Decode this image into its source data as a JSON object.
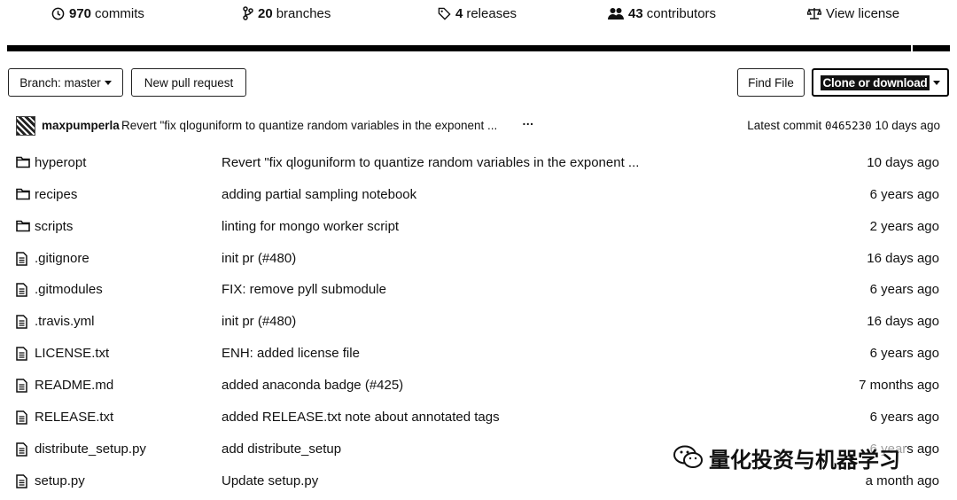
{
  "summary": {
    "commits": {
      "num": "970",
      "label": "commits",
      "icon": "history-icon"
    },
    "branches": {
      "num": "20",
      "label": "branches",
      "icon": "branch-icon"
    },
    "releases": {
      "num": "4",
      "label": "releases",
      "icon": "tag-icon"
    },
    "contributors": {
      "num": "43",
      "label": "contributors",
      "icon": "people-icon"
    },
    "license": {
      "label": "View license",
      "icon": "law-icon"
    }
  },
  "toolbar": {
    "branch_label": "Branch: master",
    "new_pr_label": "New pull request",
    "find_file_label": "Find File",
    "clone_label": "Clone or download"
  },
  "latest_commit": {
    "author": "maxpumperla",
    "message": "Revert \"fix qloguniform to quantize random variables in the exponent ...",
    "ellipsis": "…",
    "prefix": "Latest commit",
    "sha": "0465230",
    "age": "10 days ago"
  },
  "files": [
    {
      "type": "dir",
      "name": "hyperopt",
      "message": "Revert \"fix qloguniform to quantize random variables in the exponent ...",
      "age": "10 days ago"
    },
    {
      "type": "dir",
      "name": "recipes",
      "message": "adding partial sampling notebook",
      "age": "6 years ago"
    },
    {
      "type": "dir",
      "name": "scripts",
      "message": "linting for mongo worker script",
      "age": "2 years ago"
    },
    {
      "type": "file",
      "name": ".gitignore",
      "message": "init pr (#480)",
      "age": "16 days ago"
    },
    {
      "type": "file",
      "name": ".gitmodules",
      "message": "FIX: remove pyll submodule",
      "age": "6 years ago"
    },
    {
      "type": "file",
      "name": ".travis.yml",
      "message": "init pr (#480)",
      "age": "16 days ago"
    },
    {
      "type": "file",
      "name": "LICENSE.txt",
      "message": "ENH: added license file",
      "age": "6 years ago"
    },
    {
      "type": "file",
      "name": "README.md",
      "message": "added anaconda badge (#425)",
      "age": "7 months ago"
    },
    {
      "type": "file",
      "name": "RELEASE.txt",
      "message": "added RELEASE.txt note about annotated tags",
      "age": "6 years ago"
    },
    {
      "type": "file",
      "name": "distribute_setup.py",
      "message": "add distribute_setup",
      "age": "6 years ago"
    },
    {
      "type": "file",
      "name": "setup.py",
      "message": "Update setup.py",
      "age": "a month ago"
    }
  ],
  "watermark": {
    "text": "量化投资与机器学习",
    "icon": "wechat-icon"
  }
}
